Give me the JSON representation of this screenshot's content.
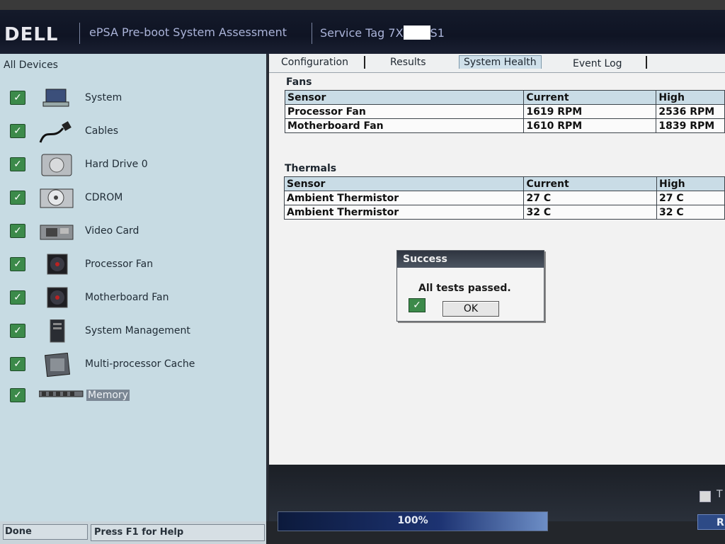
{
  "header": {
    "logo": "DELL",
    "app_title": "ePSA Pre-boot System Assessment",
    "service_tag_prefix": "Service Tag 7X",
    "service_tag_suffix": "S1"
  },
  "left_panel": {
    "title": "All Devices",
    "devices": [
      {
        "label": "System",
        "icon": "laptop-icon",
        "checked": true
      },
      {
        "label": "Cables",
        "icon": "cable-icon",
        "checked": true
      },
      {
        "label": "Hard Drive 0",
        "icon": "hard-drive-icon",
        "checked": true
      },
      {
        "label": "CDROM",
        "icon": "cdrom-icon",
        "checked": true
      },
      {
        "label": "Video Card",
        "icon": "video-card-icon",
        "checked": true
      },
      {
        "label": "Processor Fan",
        "icon": "fan-icon",
        "checked": true
      },
      {
        "label": "Motherboard Fan",
        "icon": "fan-icon",
        "checked": true
      },
      {
        "label": "System Management",
        "icon": "system-management-icon",
        "checked": true
      },
      {
        "label": "Multi-processor Cache",
        "icon": "cpu-icon",
        "checked": true
      },
      {
        "label": "Memory",
        "icon": "memory-icon",
        "checked": true,
        "selected": true
      }
    ]
  },
  "tabs": [
    "Configuration",
    "Results",
    "System Health",
    "Event Log"
  ],
  "active_tab": "System Health",
  "fans": {
    "title": "Fans",
    "headers": [
      "Sensor",
      "Current",
      "High"
    ],
    "rows": [
      [
        "Processor Fan",
        "1619 RPM",
        "2536 RPM"
      ],
      [
        "Motherboard Fan",
        "1610 RPM",
        "1839 RPM"
      ]
    ]
  },
  "thermals": {
    "title": "Thermals",
    "headers": [
      "Sensor",
      "Current",
      "High"
    ],
    "rows": [
      [
        "Ambient Thermistor",
        "27 C",
        "27 C"
      ],
      [
        "Ambient Thermistor",
        "32 C",
        "32 C"
      ]
    ]
  },
  "dialog": {
    "title": "Success",
    "message": "All tests passed.",
    "ok_label": "OK"
  },
  "progress": {
    "percent_text": "100%",
    "value": 1.0
  },
  "side": {
    "checkbox_label": "T",
    "button_label": "R"
  },
  "status": {
    "left": "Done",
    "help": "Press F1 for Help"
  },
  "colors": {
    "check_green": "#3c8a4a",
    "panel_bg": "#c7dbe3",
    "header_bg": "#141a2a"
  }
}
